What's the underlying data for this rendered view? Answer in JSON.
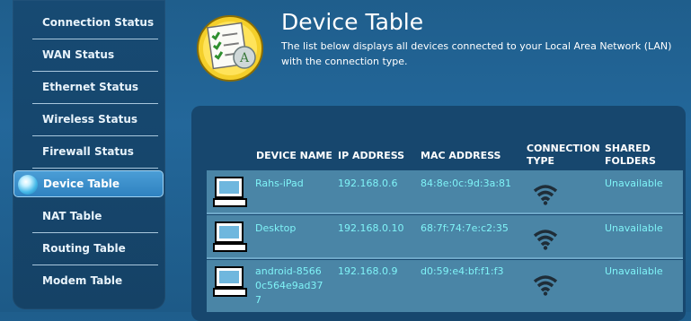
{
  "sidebar": {
    "items": [
      {
        "label": "Connection Status",
        "active": false
      },
      {
        "label": "WAN Status",
        "active": false
      },
      {
        "label": "Ethernet Status",
        "active": false
      },
      {
        "label": "Wireless Status",
        "active": false
      },
      {
        "label": "Firewall Status",
        "active": false
      },
      {
        "label": "Device Table",
        "active": true
      },
      {
        "label": "NAT Table",
        "active": false
      },
      {
        "label": "Routing Table",
        "active": false
      },
      {
        "label": "Modem Table",
        "active": false
      }
    ]
  },
  "header": {
    "title": "Device Table",
    "description": "The list below displays all devices connected to your Local Area Network (LAN) with the connection type.",
    "icon": "checklist-document-icon"
  },
  "table": {
    "columns": {
      "device_name": "DEVICE NAME",
      "ip_address": "IP ADDRESS",
      "mac_address": "MAC ADDRESS",
      "connection_type_1": "CONNECTION",
      "connection_type_2": "TYPE",
      "shared_folders_1": "SHARED",
      "shared_folders_2": "FOLDERS"
    },
    "rows": [
      {
        "device_name": "Rahs-iPad",
        "ip": "192.168.0.6",
        "mac": "84:8e:0c:9d:3a:81",
        "connection": "wifi-icon",
        "shared": "Unavailable"
      },
      {
        "device_name": "Desktop",
        "ip": "192.168.0.10",
        "mac": "68:7f:74:7e:c2:35",
        "connection": "wifi-icon",
        "shared": "Unavailable"
      },
      {
        "device_name_lines": [
          "android-8566",
          "0c564e9ad37",
          "7"
        ],
        "ip": "192.168.0.9",
        "mac": "d0:59:e4:bf:f1:f3",
        "connection": "wifi-icon",
        "shared": "Unavailable"
      }
    ]
  },
  "colors": {
    "background": "#22659a",
    "panel": "#17476e",
    "row": "#4a85a6",
    "cell_text": "#7ff3f7",
    "active_nav": "#3b8fcc"
  }
}
